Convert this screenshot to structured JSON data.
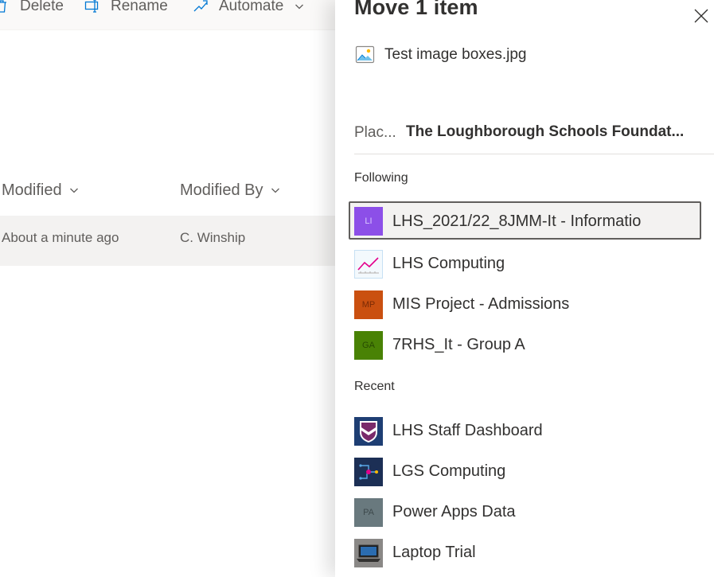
{
  "command_bar": {
    "items": [
      {
        "label": "Delete",
        "icon": "trash-icon"
      },
      {
        "label": "Rename",
        "icon": "rename-icon"
      },
      {
        "label": "Automate",
        "icon": "flow-icon"
      }
    ]
  },
  "list": {
    "columns": [
      "Modified",
      "Modified By"
    ],
    "rows": [
      {
        "modified": "About a minute ago",
        "modified_by": "C. Winship"
      }
    ]
  },
  "panel": {
    "title": "Move 1 item",
    "item_name": "Test image boxes.jpg",
    "place_label": "Plac...",
    "place_value": "The Loughborough Schools Foundat...",
    "sections": {
      "following": {
        "label": "Following",
        "sites": [
          {
            "name": "LHS_2021/22_8JMM-It - Informatio",
            "initials": "LI",
            "color": "#8c4fe8",
            "text_color": "#d9c8ff",
            "icon": "site-tile",
            "selected": true
          },
          {
            "name": "LHS Computing",
            "initials": "",
            "color": "#f3f9fd",
            "icon": "chart-line-icon",
            "selected": false
          },
          {
            "name": "MIS Project - Admissions",
            "initials": "MP",
            "color": "#ca5010",
            "text_color": "#7a2a05",
            "icon": "site-tile",
            "selected": false
          },
          {
            "name": "7RHS_It - Group A",
            "initials": "GA",
            "color": "#498205",
            "text_color": "#274a02",
            "icon": "site-tile",
            "selected": false
          }
        ]
      },
      "recent": {
        "label": "Recent",
        "sites": [
          {
            "name": "LHS Staff Dashboard",
            "initials": "",
            "color": "#1e3e73",
            "icon": "school-crest-icon",
            "selected": false
          },
          {
            "name": "LGS Computing",
            "initials": "",
            "color": "#1c2f55",
            "icon": "circuit-icon",
            "selected": false
          },
          {
            "name": "Power Apps Data",
            "initials": "PA",
            "color": "#69797e",
            "text_color": "#3e4a4d",
            "icon": "site-tile",
            "selected": false
          },
          {
            "name": "Laptop Trial",
            "initials": "",
            "color": "#6d6d6d",
            "icon": "laptop-icon",
            "selected": false
          }
        ]
      }
    }
  },
  "colors": {
    "accent": "#0078d4",
    "selection_border": "#605e5c",
    "row_hover": "#f3f2f1"
  }
}
